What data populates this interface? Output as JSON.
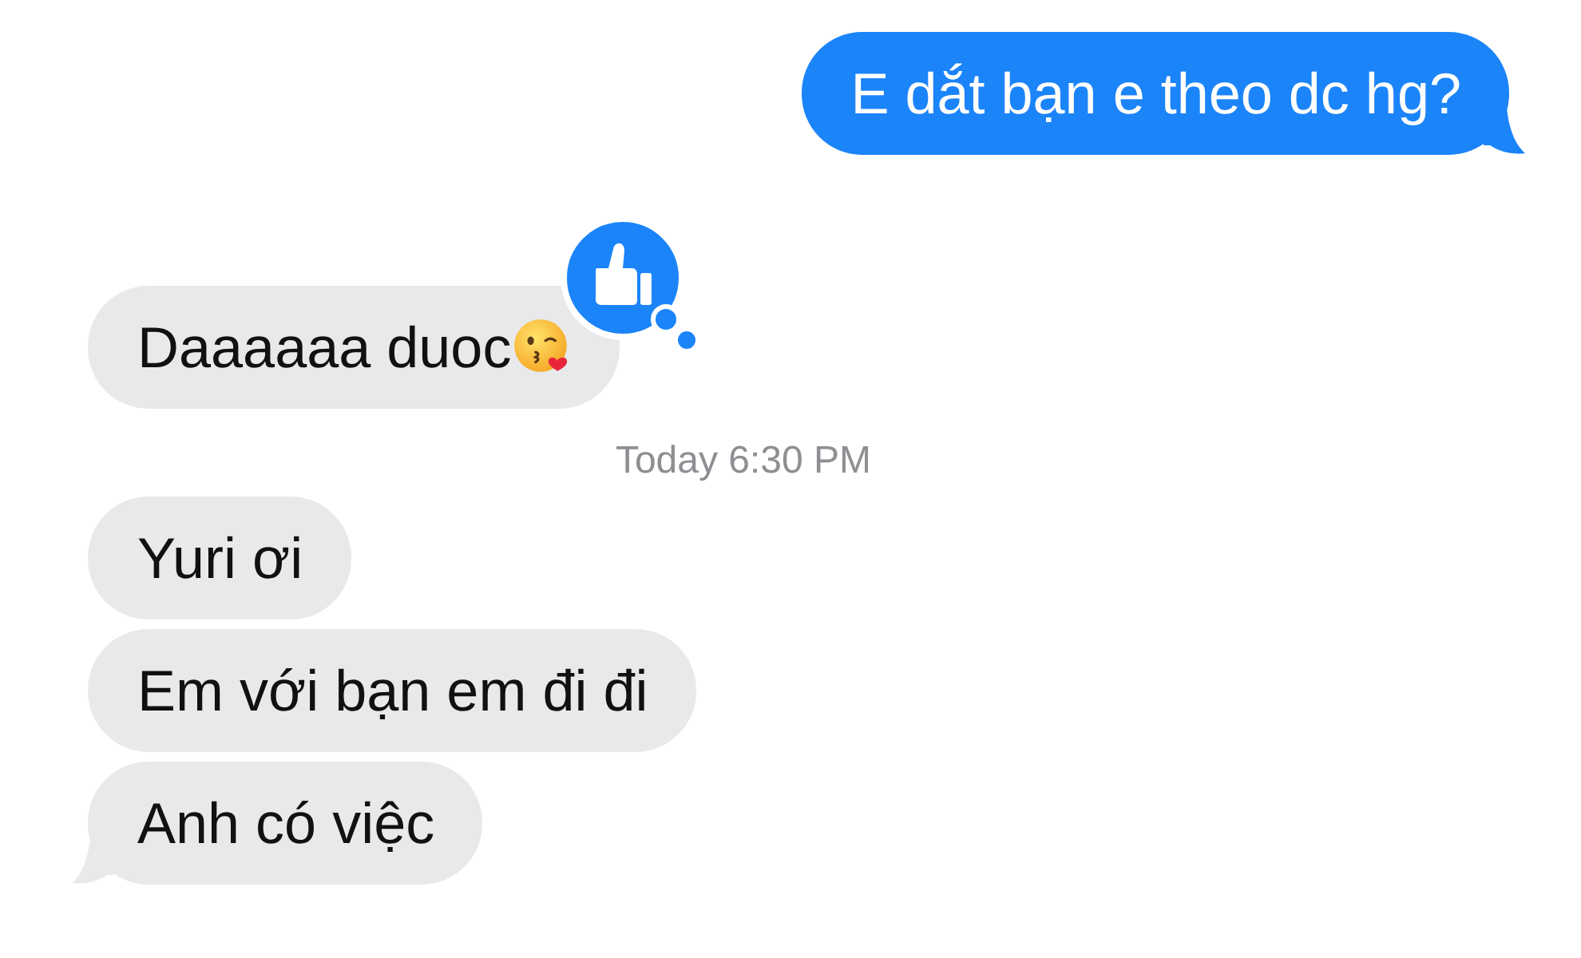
{
  "messages": [
    {
      "kind": "outgoing",
      "text": "E dắt bạn e theo dc hg?",
      "tail": true
    },
    {
      "kind": "incoming",
      "text": "Daaaaaa duoc",
      "emoji": true,
      "tapback": true,
      "tail": false
    },
    {
      "kind": "timestamp",
      "text": "Today 6:30 PM"
    },
    {
      "kind": "incoming",
      "text": "Yuri ơi",
      "tail": false
    },
    {
      "kind": "incoming",
      "text": "Em với bạn em đi đi",
      "tail": false
    },
    {
      "kind": "incoming",
      "text": "Anh có việc",
      "tail": true
    }
  ]
}
